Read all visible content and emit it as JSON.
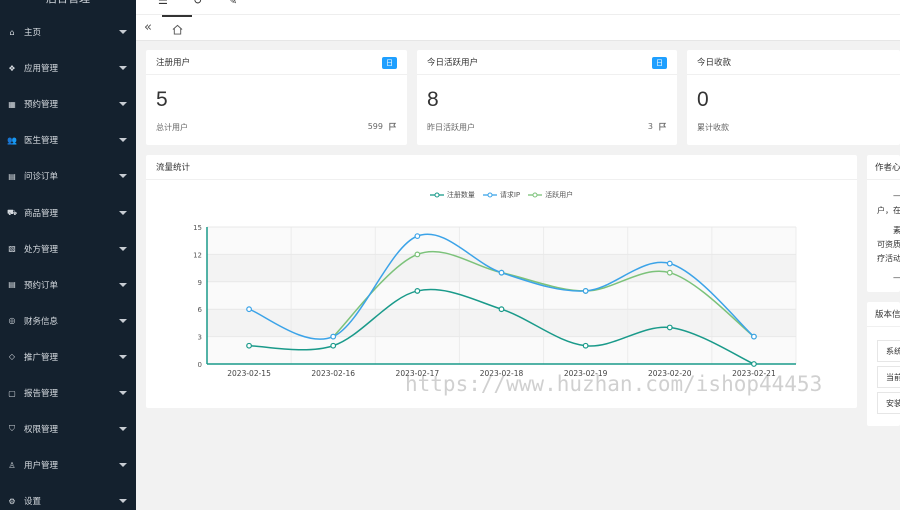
{
  "app": {
    "logo_text": "后台管理"
  },
  "sidebar": {
    "items": [
      {
        "label": "主页",
        "icon": "home-icon"
      },
      {
        "label": "应用管理",
        "icon": "apps-icon"
      },
      {
        "label": "预约管理",
        "icon": "calendar-icon"
      },
      {
        "label": "医生管理",
        "icon": "users-icon"
      },
      {
        "label": "问诊订单",
        "icon": "document-icon"
      },
      {
        "label": "商品管理",
        "icon": "cart-icon"
      },
      {
        "label": "处方管理",
        "icon": "prescription-icon"
      },
      {
        "label": "预约订单",
        "icon": "order-icon"
      },
      {
        "label": "财务信息",
        "icon": "finance-icon"
      },
      {
        "label": "推广管理",
        "icon": "diamond-icon"
      },
      {
        "label": "报告管理",
        "icon": "report-icon"
      },
      {
        "label": "权限管理",
        "icon": "shield-icon"
      },
      {
        "label": "用户管理",
        "icon": "user-icon"
      },
      {
        "label": "设置",
        "icon": "gear-icon"
      }
    ]
  },
  "stats": [
    {
      "title": "注册用户",
      "badge": "日",
      "value": "5",
      "foot_label": "总计用户",
      "foot_value": "599"
    },
    {
      "title": "今日活跃用户",
      "badge": "日",
      "value": "8",
      "foot_label": "昨日活跃用户",
      "foot_value": "3"
    },
    {
      "title": "今日收款",
      "value": "0",
      "foot_label": "累计收款"
    }
  ],
  "chart_card": {
    "title": "流量统计"
  },
  "side_card": {
    "title": "作者心",
    "lines": [
      "—",
      "户，在",
      "素",
      "可资质",
      "疗活动",
      "—"
    ]
  },
  "version_card": {
    "title": "版本信",
    "rows": [
      "系统",
      "当前",
      "安装"
    ]
  },
  "watermark": "https://www.huzhan.com/ishop44453",
  "colors": {
    "reg": "#1a9a8a",
    "ip": "#3ba3e8",
    "active": "#7cc27a",
    "sidebar_bg": "#14212e"
  },
  "chart_data": {
    "type": "line",
    "categories": [
      "2023-02-15",
      "2023-02-16",
      "2023-02-17",
      "2023-02-18",
      "2023-02-19",
      "2023-02-20",
      "2023-02-21"
    ],
    "series": [
      {
        "name": "注册数量",
        "values": [
          2,
          2,
          8,
          6,
          2,
          4,
          0
        ]
      },
      {
        "name": "请求IP",
        "values": [
          6,
          3,
          14,
          10,
          8,
          11,
          3
        ]
      },
      {
        "name": "活跃用户",
        "values": [
          null,
          3,
          12,
          10,
          8,
          10,
          3
        ]
      }
    ],
    "yticks": [
      "0",
      "3",
      "6",
      "9",
      "12",
      "15"
    ],
    "ylim": [
      0,
      15
    ],
    "legend": "top-center",
    "smooth": true
  }
}
